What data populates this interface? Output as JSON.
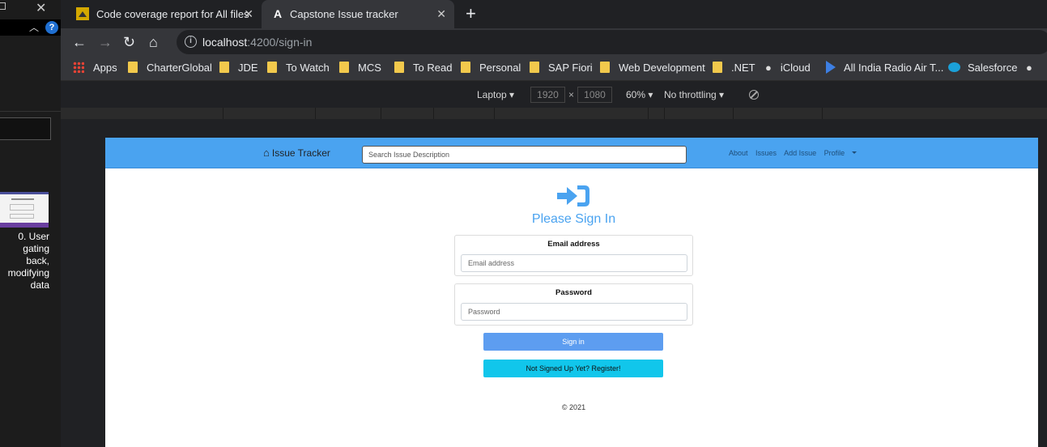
{
  "side_window": {
    "caption_lines": [
      "0. User",
      "gating back,",
      "modifying",
      "data"
    ],
    "help_label": "?"
  },
  "tabs": [
    {
      "title": "Code coverage report for All files",
      "active": false
    },
    {
      "title": "Capstone Issue tracker",
      "active": true
    }
  ],
  "tab_favicon_letter": "A",
  "new_tab_label": "+",
  "address_bar": {
    "host": "localhost",
    "path": ":4200/sign-in"
  },
  "bookmarks": [
    {
      "label": "Apps",
      "icon": "apps-grid-icon"
    },
    {
      "label": "CharterGlobal",
      "icon": "folder-icon"
    },
    {
      "label": "JDE",
      "icon": "folder-icon"
    },
    {
      "label": "To Watch",
      "icon": "folder-icon"
    },
    {
      "label": "MCS",
      "icon": "folder-icon"
    },
    {
      "label": "To Read",
      "icon": "folder-icon"
    },
    {
      "label": "Personal",
      "icon": "folder-icon"
    },
    {
      "label": "SAP Fiori",
      "icon": "folder-icon"
    },
    {
      "label": "Web Development",
      "icon": "folder-icon"
    },
    {
      "label": ".NET",
      "icon": "folder-icon"
    },
    {
      "label": "iCloud",
      "icon": "apple-icon"
    },
    {
      "label": "All India Radio Air T...",
      "icon": "play-icon"
    },
    {
      "label": "Salesforce",
      "icon": "salesforce-icon"
    }
  ],
  "devtools": {
    "device": "Laptop",
    "width": "1920",
    "times": "×",
    "height": "1080",
    "zoom": "60%",
    "throttling": "No throttling"
  },
  "app": {
    "brand": "Issue Tracker",
    "search_placeholder": "Search Issue Description",
    "nav": [
      "About",
      "Issues",
      "Add Issue",
      "Profile"
    ],
    "heading": "Please Sign In",
    "email_label": "Email address",
    "email_placeholder": "Email address",
    "password_label": "Password",
    "password_placeholder": "Password",
    "signin_button": "Sign in",
    "register_button": "Not Signed Up Yet? Register!",
    "footer": "© 2021"
  },
  "colors": {
    "navbar": "#4aa3f0",
    "heading": "#4aa3f0",
    "signin_button": "#5d9df0",
    "register_button": "#11c6eb"
  }
}
